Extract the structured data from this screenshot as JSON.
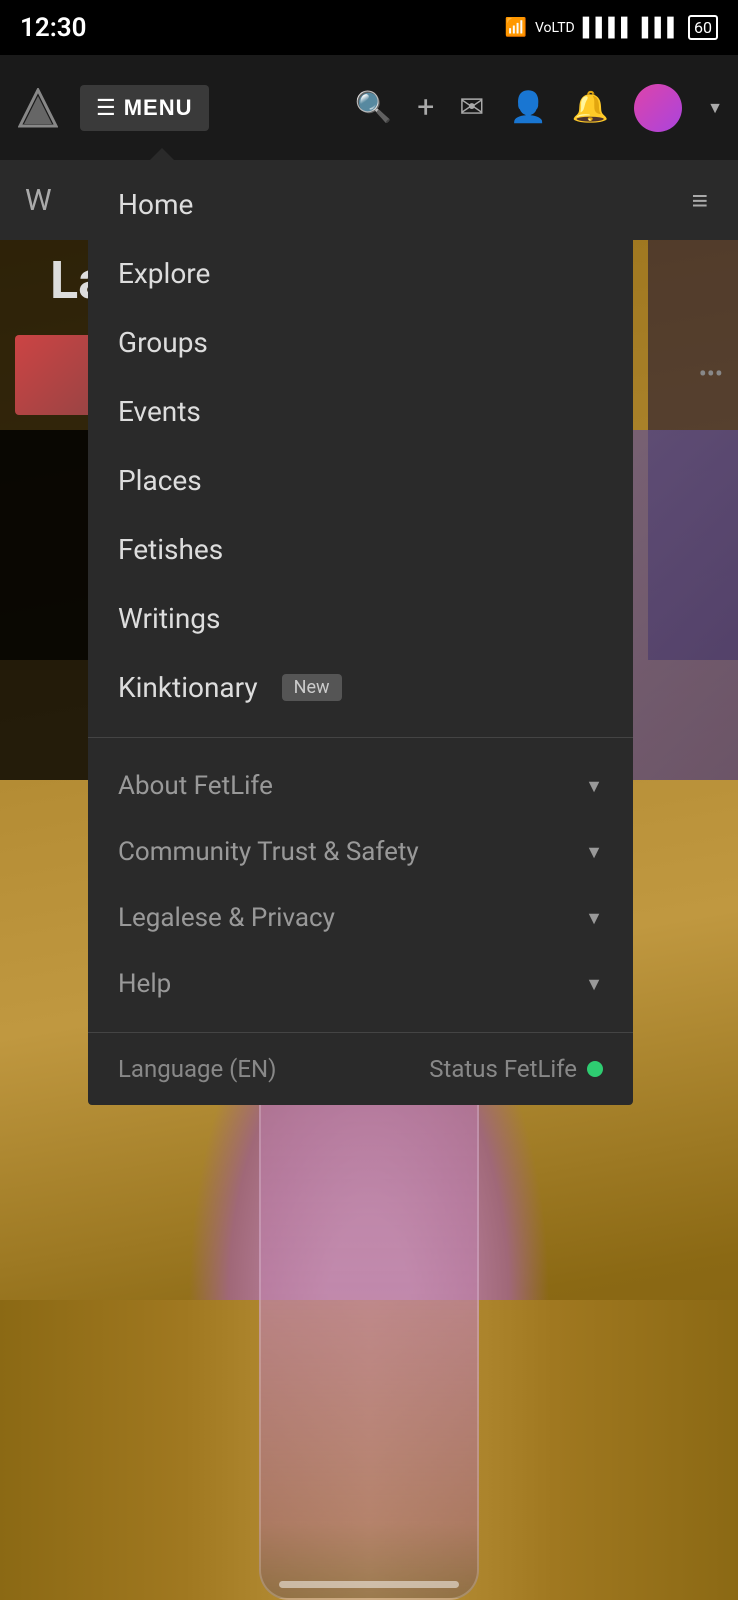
{
  "statusBar": {
    "time": "12:30",
    "battery": "60"
  },
  "navBar": {
    "menuLabel": "MENU",
    "icons": [
      "search",
      "add",
      "mail",
      "profile",
      "notification"
    ]
  },
  "menu": {
    "primaryItems": [
      {
        "id": "home",
        "label": "Home",
        "badge": null
      },
      {
        "id": "explore",
        "label": "Explore",
        "badge": null
      },
      {
        "id": "groups",
        "label": "Groups",
        "badge": null
      },
      {
        "id": "events",
        "label": "Events",
        "badge": null
      },
      {
        "id": "places",
        "label": "Places",
        "badge": null
      },
      {
        "id": "fetishes",
        "label": "Fetishes",
        "badge": null
      },
      {
        "id": "writings",
        "label": "Writings",
        "badge": null
      },
      {
        "id": "kinktionary",
        "label": "Kinktionary",
        "badge": "New"
      }
    ],
    "secondaryItems": [
      {
        "id": "about",
        "label": "About FetLife"
      },
      {
        "id": "trust",
        "label": "Community Trust & Safety"
      },
      {
        "id": "legal",
        "label": "Legalese & Privacy"
      },
      {
        "id": "help",
        "label": "Help"
      }
    ],
    "footer": {
      "language": "Language (EN)",
      "statusLabel": "Status FetLife",
      "statusDot": "green"
    }
  },
  "bgContent": {
    "wText": "W",
    "latText": "Lat"
  }
}
